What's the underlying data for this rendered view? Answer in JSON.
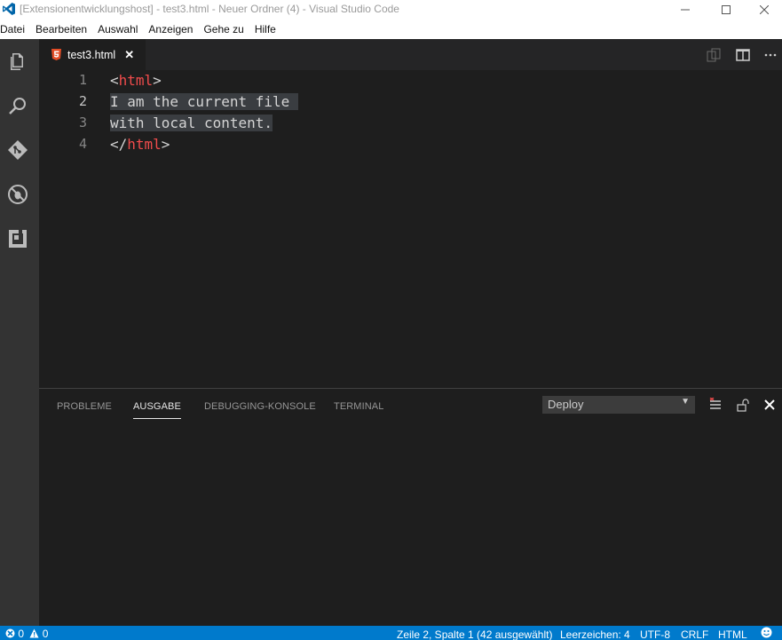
{
  "window": {
    "title": "[Extensionentwicklungshost] - test3.html - Neuer Ordner (4) - Visual Studio Code",
    "controls": [
      "minimize",
      "maximize",
      "close"
    ]
  },
  "menu": {
    "items": [
      {
        "label": "Datei"
      },
      {
        "label": "Bearbeiten"
      },
      {
        "label": "Auswahl"
      },
      {
        "label": "Anzeigen"
      },
      {
        "label": "Gehe zu"
      },
      {
        "label": "Hilfe"
      }
    ]
  },
  "activity_bar": {
    "icons": [
      "explorer-icon",
      "search-icon",
      "git-icon",
      "debug-icon",
      "extensions-icon"
    ]
  },
  "tabs": [
    {
      "label": "test3.html",
      "icon": "html5-icon",
      "active": true
    }
  ],
  "editor": {
    "lines": [
      {
        "number": "1",
        "open": "<",
        "tag": "html",
        "close": ">",
        "text": ""
      },
      {
        "number": "2",
        "open": "",
        "tag": "",
        "close": "",
        "text": "I am the current file "
      },
      {
        "number": "3",
        "open": "",
        "tag": "",
        "close": "",
        "text": "with local content."
      },
      {
        "number": "4",
        "open": "</",
        "tag": "html",
        "close": ">",
        "text": ""
      }
    ]
  },
  "panel": {
    "tabs": [
      {
        "label": "PROBLEME",
        "active": false
      },
      {
        "label": "AUSGABE",
        "active": true
      },
      {
        "label": "DEBUGGING-KONSOLE",
        "active": false
      },
      {
        "label": "TERMINAL",
        "active": false
      }
    ],
    "output_channel": {
      "selected": "Deploy"
    }
  },
  "status_bar": {
    "errors": "0",
    "warnings": "0",
    "position": "Zeile 2, Spalte 1 (42 ausgewählt)",
    "indent": "Leerzeichen: 4",
    "encoding": "UTF-8",
    "eol": "CRLF",
    "language": "HTML"
  },
  "colors": {
    "accent": "#007acc",
    "tag": "#f14c4c",
    "editor_bg": "#1e1e1e",
    "activity_bar": "#333333"
  }
}
